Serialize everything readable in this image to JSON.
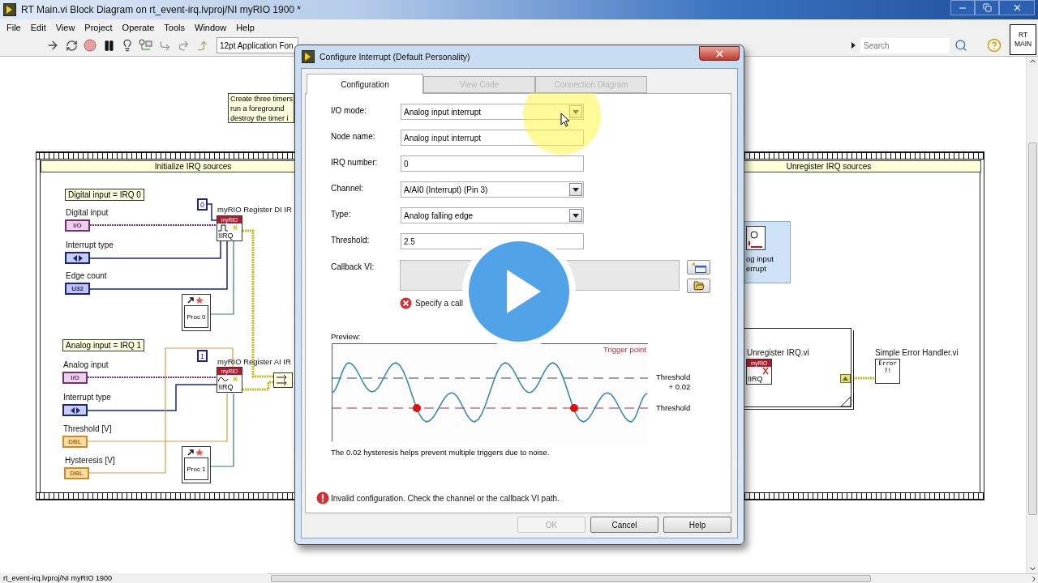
{
  "window": {
    "title": "RT Main.vi Block Diagram on rt_event-irq.lvproj/NI myRIO 1900 *"
  },
  "menu": [
    "File",
    "Edit",
    "View",
    "Project",
    "Operate",
    "Tools",
    "Window",
    "Help"
  ],
  "toolbar": {
    "font": "12pt Application Fon",
    "search": {
      "placeholder": "Search"
    },
    "vi_icon": "RT\nMAIN"
  },
  "diagram": {
    "comment": "Create three timers\nrun a foreground\ndestroy the timer i",
    "frames": [
      "Initialize IRQ sources",
      "Unregister IRQ sources"
    ],
    "items": [
      {
        "kind": "group_label",
        "text": "Digital input = IRQ 0"
      },
      {
        "kind": "label",
        "text": "Digital input"
      },
      {
        "kind": "terminal_io",
        "text": "I/O"
      },
      {
        "kind": "label",
        "text": "Interrupt type"
      },
      {
        "kind": "terminal_enum"
      },
      {
        "kind": "label",
        "text": "Edge count"
      },
      {
        "kind": "terminal_u32",
        "text": "U32"
      },
      {
        "kind": "constant",
        "text": "0"
      },
      {
        "kind": "node_label",
        "text": "myRIO Register DI IR"
      },
      {
        "kind": "node_pulse",
        "header": "myRIO",
        "text": "!IRQ"
      },
      {
        "kind": "vi_ref",
        "text": "Proc 0"
      },
      {
        "kind": "group_label",
        "text": "Analog input = IRQ 1"
      },
      {
        "kind": "label",
        "text": "Analog input"
      },
      {
        "kind": "terminal_io",
        "text": "I/O"
      },
      {
        "kind": "label",
        "text": "Interrupt type"
      },
      {
        "kind": "terminal_enum"
      },
      {
        "kind": "label",
        "text": "Threshold [V]"
      },
      {
        "kind": "terminal_dbl",
        "text": "DBL"
      },
      {
        "kind": "label",
        "text": "Hysteresis [V]"
      },
      {
        "kind": "terminal_dbl",
        "text": "DBL"
      },
      {
        "kind": "constant",
        "text": "1"
      },
      {
        "kind": "node_label",
        "text": "myRIO Register AI IR"
      },
      {
        "kind": "node_wave",
        "header": "myRIO",
        "text": "!IRQ"
      },
      {
        "kind": "vi_ref",
        "text": "Proc 1"
      },
      {
        "kind": "merge"
      },
      {
        "kind": "express",
        "text": "og input\nerrupt"
      },
      {
        "kind": "subvi_frame"
      },
      {
        "kind": "label",
        "text": "Unregister IRQ.vi"
      },
      {
        "kind": "node_close",
        "header": "myRIO",
        "text": "!IRQ"
      },
      {
        "kind": "tunnel"
      },
      {
        "kind": "label",
        "text": "Simple Error Handler.vi"
      },
      {
        "kind": "error_handler",
        "text": "Error",
        "subtext": "?!"
      }
    ]
  },
  "dialog": {
    "title": "Configure Interrupt (Default Personality)",
    "tabs": [
      {
        "label": "Configuration",
        "selected": true
      },
      {
        "label": "View Code",
        "selected": false
      },
      {
        "label": "Connection Diagram",
        "selected": false
      }
    ],
    "fields": [
      {
        "label": "I/O mode:",
        "kind": "dropdown",
        "value": "Analog input interrupt"
      },
      {
        "label": "Node name:",
        "kind": "text",
        "value": "Analog input interrupt"
      },
      {
        "label": "IRQ number:",
        "kind": "text",
        "value": "0"
      },
      {
        "label": "Channel:",
        "kind": "dropdown",
        "value": "A/AI0 (Interrupt) (Pin 3)"
      },
      {
        "label": "Type:",
        "kind": "dropdown",
        "value": "Analog falling edge"
      },
      {
        "label": "Threshold:",
        "kind": "text",
        "value": "2.5"
      }
    ],
    "callback": {
      "label": "Callback VI:",
      "error": "Specify a call"
    },
    "preview": {
      "label": "Preview:",
      "trigger_label": "Trigger point",
      "upper_label": "Threshold\n+ 0.02",
      "lower_label": "Threshold",
      "note": "The 0.02 hysteresis helps prevent multiple triggers due to noise."
    },
    "error": "Invalid configuration. Check the channel or the callback VI path.",
    "buttons": [
      {
        "label": "OK",
        "disabled": true
      },
      {
        "label": "Cancel",
        "disabled": false
      },
      {
        "label": "Help",
        "disabled": false
      }
    ]
  },
  "status_bar": "rt_event-irq.lvproj/NI myRIO 1900"
}
